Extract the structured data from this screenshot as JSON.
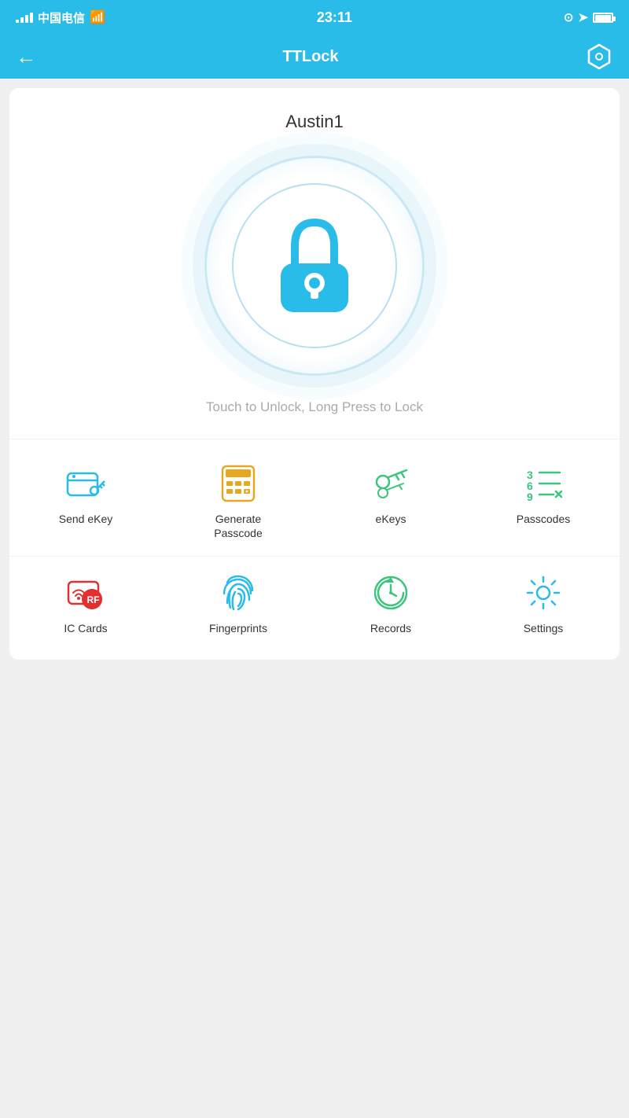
{
  "statusBar": {
    "carrier": "中国电信",
    "time": "23:11"
  },
  "header": {
    "title": "TTLock",
    "back_label": "←",
    "settings_label": "⬡"
  },
  "lock": {
    "name": "Austin1",
    "hint": "Touch to Unlock, Long Press to Lock"
  },
  "grid": {
    "row1": [
      {
        "id": "send-ekey",
        "label": "Send eKey",
        "icon": "send-ekey-icon"
      },
      {
        "id": "generate-passcode",
        "label": "Generate\nPasscode",
        "icon": "passcode-gen-icon"
      },
      {
        "id": "ekeys",
        "label": "eKeys",
        "icon": "ekeys-icon"
      },
      {
        "id": "passcodes",
        "label": "Passcodes",
        "icon": "passcodes-icon"
      }
    ],
    "row2": [
      {
        "id": "ic-cards",
        "label": "IC Cards",
        "icon": "ic-cards-icon"
      },
      {
        "id": "fingerprints",
        "label": "Fingerprints",
        "icon": "fingerprints-icon"
      },
      {
        "id": "records",
        "label": "Records",
        "icon": "records-icon"
      },
      {
        "id": "settings",
        "label": "Settings",
        "icon": "settings-icon"
      }
    ]
  }
}
